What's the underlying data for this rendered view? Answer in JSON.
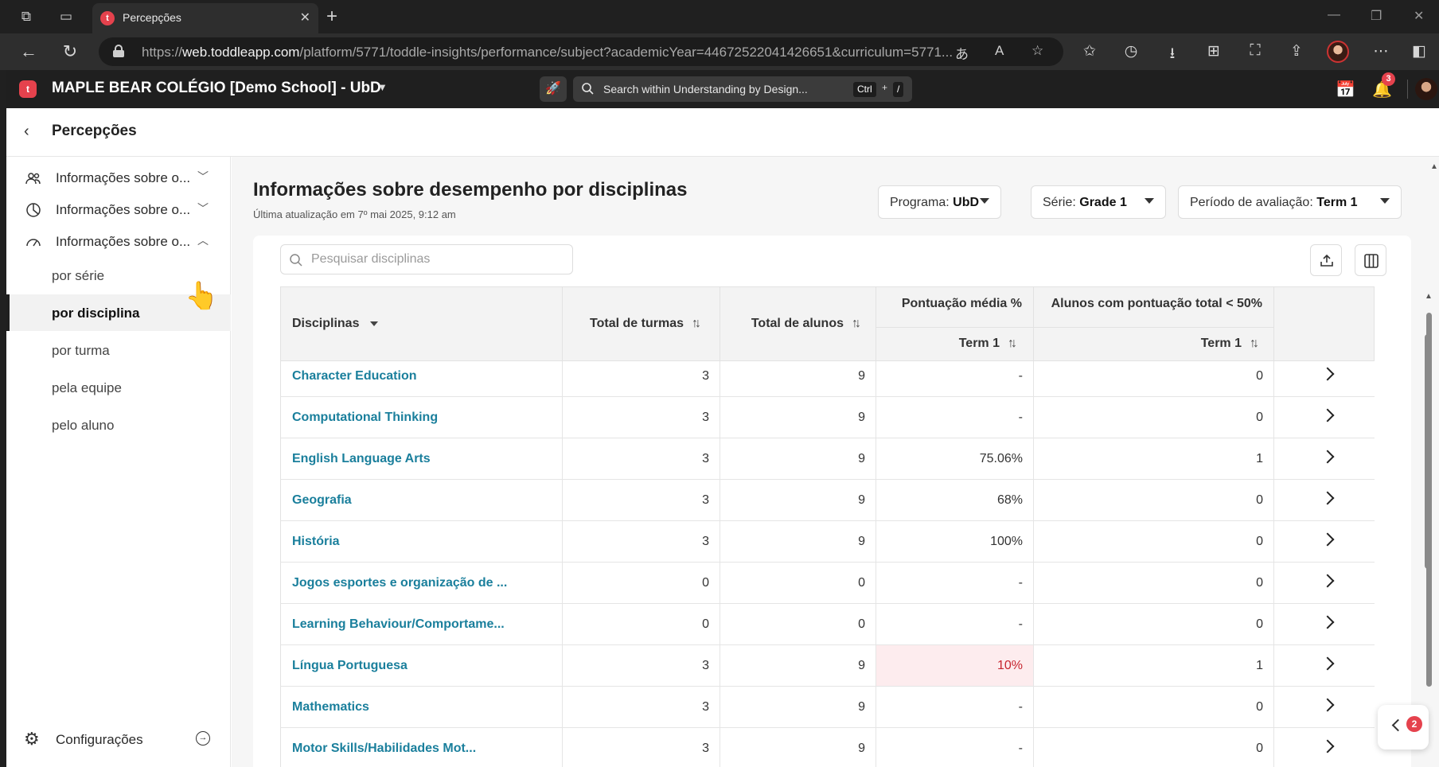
{
  "browser": {
    "tab_title": "Percepções",
    "url_prefix": "https://",
    "url_host": "web.toddleapp.com",
    "url_path": "/platform/5771/toddle-insights/performance/subject?academicYear=44672522041426651&curriculum=5771..."
  },
  "header": {
    "school": "MAPLE BEAR COLÉGIO [Demo School] - UbD",
    "search_placeholder": "Search within Understanding by Design...",
    "shortcut_key1": "Ctrl",
    "shortcut_plus": "+",
    "shortcut_key2": "/",
    "notifications_count": "3"
  },
  "topbar": {
    "title": "Percepções"
  },
  "sidebar": {
    "groups": [
      {
        "label": "Informações sobre o..."
      },
      {
        "label": "Informações sobre o..."
      },
      {
        "label": "Informações sobre o..."
      }
    ],
    "items": [
      {
        "label": "por série"
      },
      {
        "label": "por disciplina"
      },
      {
        "label": "por turma"
      },
      {
        "label": "pela equipe"
      },
      {
        "label": "pelo aluno"
      }
    ],
    "settings_label": "Configurações"
  },
  "main": {
    "title": "Informações sobre desempenho por disciplinas",
    "updated": "Última atualização em 7º mai 2025, 9:12 am",
    "filters": [
      {
        "label": "Programa:",
        "value": "UbD"
      },
      {
        "label": "Série:",
        "value": "Grade 1"
      },
      {
        "label": "Período de avaliação:",
        "value": "Term 1"
      }
    ],
    "search_placeholder": "Pesquisar disciplinas"
  },
  "table": {
    "headers": {
      "subject": "Disciplinas",
      "classes": "Total de turmas",
      "students": "Total de alunos",
      "avg_score": "Pontuação média %",
      "below50": "Alunos com pontuação total < 50%",
      "term_avg": "Term 1",
      "term_below": "Term 1"
    },
    "rows": [
      {
        "subject": "Character Education",
        "classes": "3",
        "students": "9",
        "avg": "-",
        "below": "0"
      },
      {
        "subject": "Computational Thinking",
        "classes": "3",
        "students": "9",
        "avg": "-",
        "below": "0"
      },
      {
        "subject": "English Language Arts",
        "classes": "3",
        "students": "9",
        "avg": "75.06%",
        "below": "1"
      },
      {
        "subject": "Geografia",
        "classes": "3",
        "students": "9",
        "avg": "68%",
        "below": "0"
      },
      {
        "subject": "História",
        "classes": "3",
        "students": "9",
        "avg": "100%",
        "below": "0"
      },
      {
        "subject": "Jogos esportes e organização de ...",
        "classes": "0",
        "students": "0",
        "avg": "-",
        "below": "0"
      },
      {
        "subject": "Learning Behaviour/Comportame...",
        "classes": "0",
        "students": "0",
        "avg": "-",
        "below": "0"
      },
      {
        "subject": "Língua Portuguesa",
        "classes": "3",
        "students": "9",
        "avg": "10%",
        "below": "1",
        "highlight": true
      },
      {
        "subject": "Mathematics",
        "classes": "3",
        "students": "9",
        "avg": "-",
        "below": "0"
      },
      {
        "subject": "Motor Skills/Habilidades Mot...",
        "classes": "3",
        "students": "9",
        "avg": "-",
        "below": "0"
      }
    ]
  },
  "floating": {
    "badge": "2"
  },
  "colors": {
    "accent": "#e5424d",
    "link": "#1a7f9c",
    "low_score_bg": "#fdecee"
  }
}
